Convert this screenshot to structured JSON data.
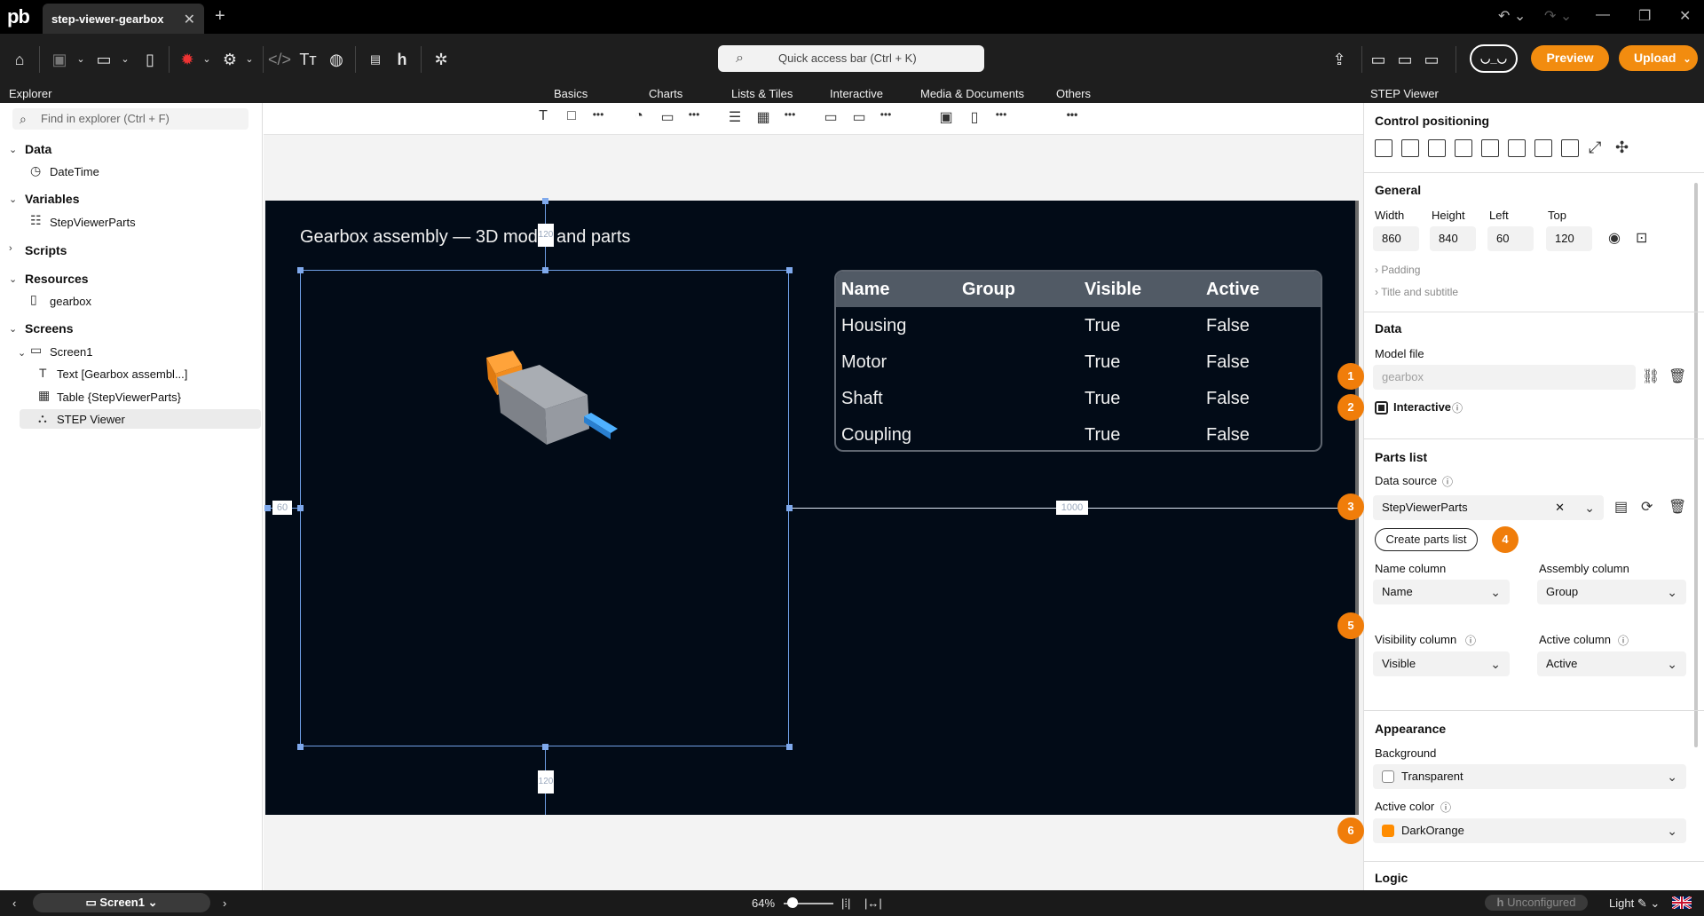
{
  "app": {
    "tab_title": "step-viewer-gearbox",
    "tab_close": "✕",
    "new_tab": "+",
    "logo_text": "pb"
  },
  "toolbar": {
    "search_placeholder": "Quick access bar (Ctrl + K)",
    "preview_label": "Preview",
    "upload_label": "Upload",
    "robot_face": "◡_◡",
    "accent": "#f28c0f"
  },
  "strip": {
    "explorer_title": "Explorer",
    "categories": [
      "Basics",
      "Charts",
      "Lists & Tiles",
      "Interactive",
      "Media & Documents",
      "Others"
    ],
    "panel_title": "STEP Viewer"
  },
  "explorer": {
    "find_placeholder": "Find in explorer (Ctrl + F)",
    "sections": {
      "data": "Data",
      "data_item": "DateTime",
      "variables": "Variables",
      "variables_item": "StepViewerParts",
      "scripts": "Scripts",
      "resources": "Resources",
      "resources_item": "gearbox",
      "screens": "Screens",
      "screen1": "Screen1",
      "screen_children": [
        "Text [Gearbox assembl...]",
        "Table {StepViewerParts}",
        "STEP Viewer"
      ]
    }
  },
  "canvas": {
    "screen_title": "Gearbox assembly — 3D model and parts",
    "dims": {
      "top": "120",
      "left": "60",
      "right": "1000",
      "bottom": "120"
    },
    "table": {
      "headers": [
        "Name",
        "Group",
        "Visible",
        "Active"
      ],
      "rows": [
        [
          "Housing",
          "",
          "True",
          "False"
        ],
        [
          "Motor",
          "",
          "True",
          "False"
        ],
        [
          "Shaft",
          "",
          "True",
          "False"
        ],
        [
          "Coupling",
          "",
          "True",
          "False"
        ]
      ]
    }
  },
  "panel": {
    "control_positioning": "Control positioning",
    "general": {
      "title": "General",
      "width_label": "Width",
      "height_label": "Height",
      "left_label": "Left",
      "top_label": "Top",
      "width": "860",
      "height": "840",
      "left": "60",
      "top": "120",
      "padding": "Padding",
      "title_subtitle": "Title and subtitle"
    },
    "data": {
      "title": "Data",
      "model_file_label": "Model file",
      "model_file_value": "gearbox",
      "interactive_label": "Interactive"
    },
    "parts_list": {
      "title": "Parts list",
      "data_source_label": "Data source",
      "data_source_value": "StepViewerParts",
      "create_button": "Create parts list",
      "name_column_label": "Name column",
      "name_column_value": "Name",
      "assembly_column_label": "Assembly column",
      "assembly_column_value": "Group",
      "visibility_column_label": "Visibility column",
      "visibility_column_value": "Visible",
      "active_column_label": "Active column",
      "active_column_value": "Active"
    },
    "appearance": {
      "title": "Appearance",
      "background_label": "Background",
      "background_value": "Transparent",
      "active_color_label": "Active color",
      "active_color_value": "DarkOrange",
      "active_color_hex": "#ff8c00"
    },
    "logic_title": "Logic",
    "steps": [
      "1",
      "2",
      "3",
      "4",
      "5",
      "6"
    ]
  },
  "statusbar": {
    "screen_name": "Screen1",
    "zoom": "64%",
    "unconfigured": "Unconfigured",
    "theme": "Light"
  }
}
